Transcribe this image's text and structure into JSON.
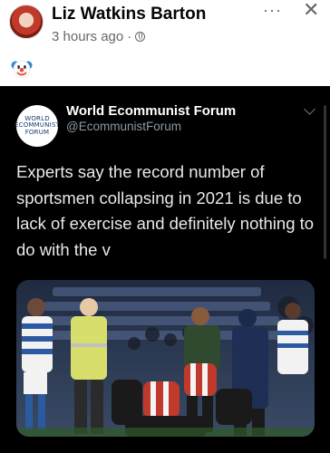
{
  "post": {
    "author": "Liz Watkins Barton",
    "time": "3 hours ago",
    "separator": "·",
    "more_label": "···",
    "close_label": "✕",
    "reaction_emoji": "🤡"
  },
  "tweet": {
    "org_name": "World Ecommunist Forum",
    "handle": "@EcommunistForum",
    "text": "Experts say the record number of sportsmen collapsing in 2021 is due to lack of exercise and definitely nothing to do with the v",
    "logo_lines": [
      "WORLD",
      "ECOMMUNIST",
      "FORUM"
    ]
  },
  "colors": {
    "tweet_background": "#000000",
    "tweet_text": "#e7e9ea",
    "handle": "#8b98a5",
    "meta_gray": "#65676b"
  }
}
